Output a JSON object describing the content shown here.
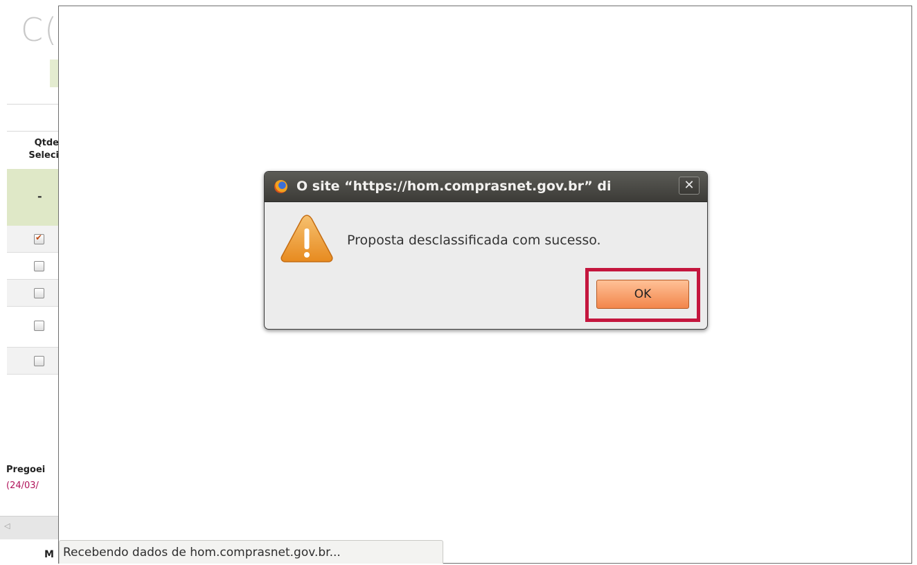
{
  "background": {
    "logo_text": "C(",
    "table_header_line1": "Qtde",
    "table_header_line2": "Seleci",
    "green_row_value": "-",
    "checkbox_rows": [
      {
        "checked": true
      },
      {
        "checked": false
      },
      {
        "checked": false
      },
      {
        "checked": false
      },
      {
        "checked": false
      }
    ],
    "pregoeiro_label": "Pregoei",
    "date_fragment": "(24/03/",
    "scroll_arrow": "◁",
    "bottom_label": "M"
  },
  "dialog": {
    "title": "O site “https://hom.comprasnet.gov.br” di",
    "close_symbol": "✕",
    "message": "Proposta desclassificada com sucesso.",
    "ok_label": "OK",
    "highlight_color": "#c4163e"
  },
  "status_bar": {
    "text": "Recebendo dados de hom.comprasnet.gov.br..."
  }
}
